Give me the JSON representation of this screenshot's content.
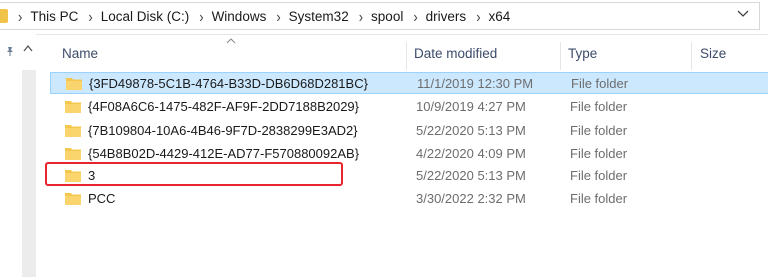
{
  "address_bar": {
    "breadcrumbs": [
      "This PC",
      "Local Disk (C:)",
      "Windows",
      "System32",
      "spool",
      "drivers",
      "x64"
    ],
    "dropdown_icon": "chevron-down-icon"
  },
  "columns": {
    "name": "Name",
    "date_modified": "Date modified",
    "type": "Type",
    "size": "Size"
  },
  "files": [
    {
      "name": "{3FD49878-5C1B-4764-B33D-DB6D68D281BC}",
      "date": "11/1/2019 12:30 PM",
      "type": "File folder",
      "selected": true
    },
    {
      "name": "{4F08A6C6-1475-482F-AF9F-2DD7188B2029}",
      "date": "10/9/2019 4:27 PM",
      "type": "File folder",
      "selected": false
    },
    {
      "name": "{7B109804-10A6-4B46-9F7D-2838299E3AD2}",
      "date": "5/22/2020 5:13 PM",
      "type": "File folder",
      "selected": false
    },
    {
      "name": "{54B8B02D-4429-412E-AD77-F570880092AB}",
      "date": "4/22/2020 4:09 PM",
      "type": "File folder",
      "selected": false
    },
    {
      "name": "3",
      "date": "5/22/2020 5:13 PM",
      "type": "File folder",
      "selected": false,
      "highlighted": true
    },
    {
      "name": "PCC",
      "date": "3/30/2022 2:32 PM",
      "type": "File folder",
      "selected": false
    }
  ],
  "colors": {
    "folder": "#f4c84f",
    "selection": "#cce8ff",
    "annotation": "#e8242c"
  }
}
